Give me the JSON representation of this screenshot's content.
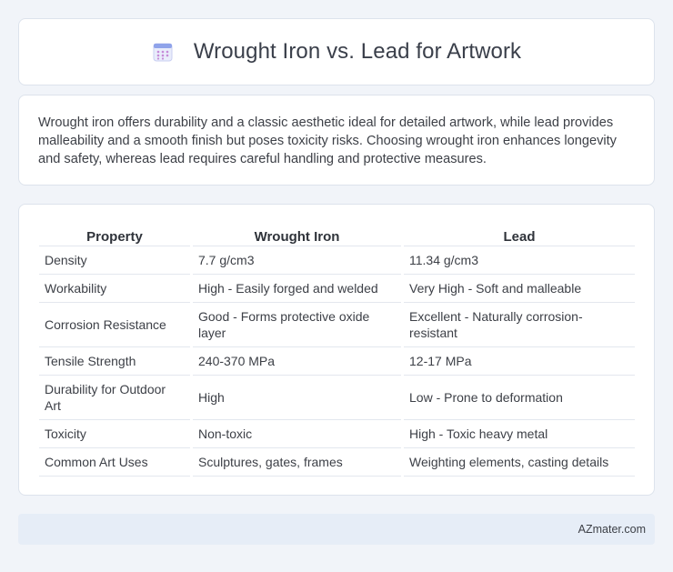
{
  "header": {
    "title": "Wrought Iron vs. Lead for Artwork",
    "icon": "calendar-icon"
  },
  "summary": {
    "text": "Wrought iron offers durability and a classic aesthetic ideal for detailed artwork, while lead provides malleability and a smooth finish but poses toxicity risks. Choosing wrought iron enhances longevity and safety, whereas lead requires careful handling and protective measures."
  },
  "table": {
    "headers": [
      "Property",
      "Wrought Iron",
      "Lead"
    ],
    "rows": [
      [
        "Density",
        "7.7 g/cm3",
        "11.34 g/cm3"
      ],
      [
        "Workability",
        "High - Easily forged and welded",
        "Very High - Soft and malleable"
      ],
      [
        "Corrosion Resistance",
        "Good - Forms protective oxide layer",
        "Excellent - Naturally corrosion-resistant"
      ],
      [
        "Tensile Strength",
        "240-370 MPa",
        "12-17 MPa"
      ],
      [
        "Durability for Outdoor Art",
        "High",
        "Low - Prone to deformation"
      ],
      [
        "Toxicity",
        "Non-toxic",
        "High - Toxic heavy metal"
      ],
      [
        "Common Art Uses",
        "Sculptures, gates, frames",
        "Weighting elements, casting details"
      ]
    ]
  },
  "footer": {
    "text": "AZmater.com"
  },
  "colors": {
    "background": "#f1f4f9",
    "card": "#ffffff",
    "footer": "#e6edf7",
    "icon_accent": "#7b8fe0"
  }
}
